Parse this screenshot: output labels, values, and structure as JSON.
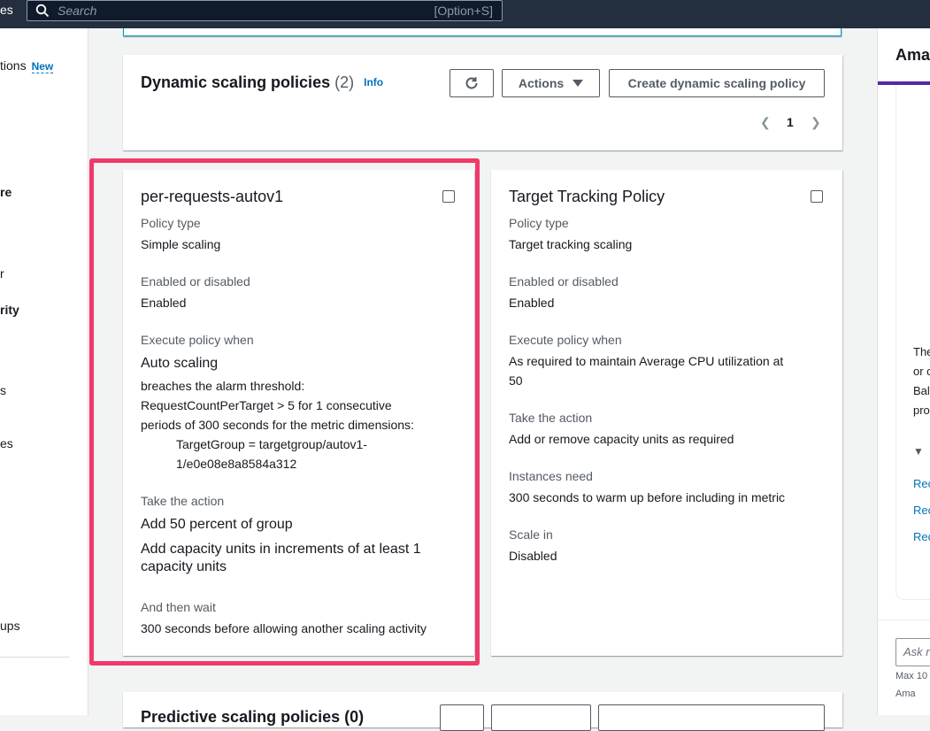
{
  "topbar": {
    "left_fragment": "es",
    "search_placeholder": "Search",
    "search_shortcut": "[Option+S]"
  },
  "leftnav": {
    "items": [
      {
        "label": "tions",
        "badge": "New"
      },
      {
        "label": "re"
      },
      {
        "label": "r"
      },
      {
        "label": "rity"
      },
      {
        "label": "s"
      },
      {
        "label": "es"
      },
      {
        "label": "ups"
      }
    ]
  },
  "dynamic": {
    "title": "Dynamic scaling policies",
    "count": "(2)",
    "info": "Info",
    "actions_label": "Actions",
    "create_label": "Create dynamic scaling policy",
    "page": "1"
  },
  "card1": {
    "title": "per-requests-autov1",
    "policy_type_label": "Policy type",
    "policy_type": "Simple scaling",
    "enabled_label": "Enabled or disabled",
    "enabled": "Enabled",
    "execute_label": "Execute policy when",
    "execute_main": "Auto scaling",
    "execute_l1": "breaches the alarm threshold:",
    "execute_l2": "RequestCountPerTarget > 5 for 1 consecutive",
    "execute_l3": "periods of 300 seconds for the metric dimensions:",
    "execute_l4": "TargetGroup = targetgroup/autov1-",
    "execute_l5": "1/e0e08e8a8584a312",
    "action_label": "Take the action",
    "action_main": "Add 50 percent of group",
    "action_l1": "Add capacity units in increments of at least 1",
    "action_l2": "capacity units",
    "wait_label": "And then wait",
    "wait": "300 seconds before allowing another scaling activity"
  },
  "card2": {
    "title": "Target Tracking Policy",
    "policy_type_label": "Policy type",
    "policy_type": "Target tracking scaling",
    "enabled_label": "Enabled or disabled",
    "enabled": "Enabled",
    "execute_label": "Execute policy when",
    "execute_l1": "As required to maintain Average CPU utilization at",
    "execute_l2": "50",
    "action_label": "Take the action",
    "action": "Add or remove capacity units as required",
    "instances_label": "Instances need",
    "instances": "300 seconds to warm up before including in metric",
    "scalein_label": "Scale in",
    "scalein": "Disabled"
  },
  "predictive": {
    "title_fragment": "Predictive scaling policies (0)"
  },
  "help": {
    "title_fragment": "Ama",
    "text_lines": [
      "The",
      "or c",
      "Bal",
      "pro"
    ],
    "links": [
      "Rec",
      "Rec",
      "Rec"
    ],
    "input_placeholder": "Ask r",
    "small_1": "Max 10",
    "small_2": "Ama"
  },
  "colors": {
    "highlight": "#f1396a",
    "link": "#0073bb",
    "topbar": "#232f3e",
    "accent_bar": "#5629a8"
  }
}
